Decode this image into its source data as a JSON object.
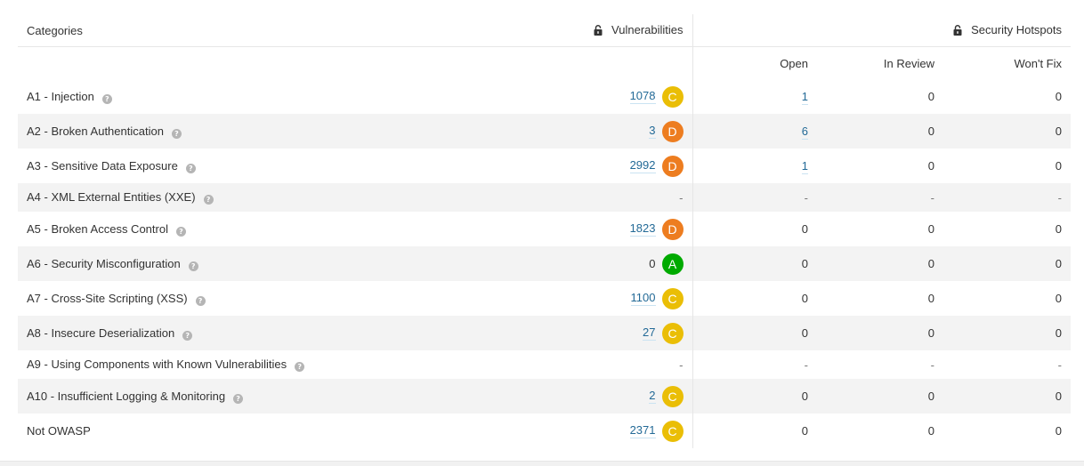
{
  "headers": {
    "categories": "Categories",
    "vulnerabilities": "Vulnerabilities",
    "security_hotspots": "Security Hotspots",
    "open": "Open",
    "in_review": "In Review",
    "wont_fix": "Won't Fix"
  },
  "icons": {
    "lock": "lock-icon",
    "help": "help-icon"
  },
  "help_glyph": "?",
  "rating_colors": {
    "A": "#00aa00",
    "C": "#eabe06",
    "D": "#ed7d20"
  },
  "rows": [
    {
      "category": "A1 - Injection",
      "help": true,
      "vulnerabilities": "1078",
      "vuln_link": true,
      "rating": "C",
      "open": "1",
      "open_link": true,
      "in_review": "0",
      "wont_fix": "0"
    },
    {
      "category": "A2 - Broken Authentication",
      "help": true,
      "vulnerabilities": "3",
      "vuln_link": true,
      "rating": "D",
      "open": "6",
      "open_link": true,
      "in_review": "0",
      "wont_fix": "0"
    },
    {
      "category": "A3 - Sensitive Data Exposure",
      "help": true,
      "vulnerabilities": "2992",
      "vuln_link": true,
      "rating": "D",
      "open": "1",
      "open_link": true,
      "in_review": "0",
      "wont_fix": "0"
    },
    {
      "category": "A4 - XML External Entities (XXE)",
      "help": true,
      "vulnerabilities": "-",
      "vuln_link": false,
      "rating": null,
      "open": "-",
      "open_link": false,
      "in_review": "-",
      "wont_fix": "-"
    },
    {
      "category": "A5 - Broken Access Control",
      "help": true,
      "vulnerabilities": "1823",
      "vuln_link": true,
      "rating": "D",
      "open": "0",
      "open_link": false,
      "in_review": "0",
      "wont_fix": "0"
    },
    {
      "category": "A6 - Security Misconfiguration",
      "help": true,
      "vulnerabilities": "0",
      "vuln_link": false,
      "rating": "A",
      "open": "0",
      "open_link": false,
      "in_review": "0",
      "wont_fix": "0"
    },
    {
      "category": "A7 - Cross-Site Scripting (XSS)",
      "help": true,
      "vulnerabilities": "1100",
      "vuln_link": true,
      "rating": "C",
      "open": "0",
      "open_link": false,
      "in_review": "0",
      "wont_fix": "0"
    },
    {
      "category": "A8 - Insecure Deserialization",
      "help": true,
      "vulnerabilities": "27",
      "vuln_link": true,
      "rating": "C",
      "open": "0",
      "open_link": false,
      "in_review": "0",
      "wont_fix": "0"
    },
    {
      "category": "A9 - Using Components with Known Vulnerabilities",
      "help": true,
      "vulnerabilities": "-",
      "vuln_link": false,
      "rating": null,
      "open": "-",
      "open_link": false,
      "in_review": "-",
      "wont_fix": "-"
    },
    {
      "category": "A10 - Insufficient Logging & Monitoring",
      "help": true,
      "vulnerabilities": "2",
      "vuln_link": true,
      "rating": "C",
      "open": "0",
      "open_link": false,
      "in_review": "0",
      "wont_fix": "0"
    },
    {
      "category": "Not OWASP",
      "help": false,
      "vulnerabilities": "2371",
      "vuln_link": true,
      "rating": "C",
      "open": "0",
      "open_link": false,
      "in_review": "0",
      "wont_fix": "0"
    }
  ]
}
